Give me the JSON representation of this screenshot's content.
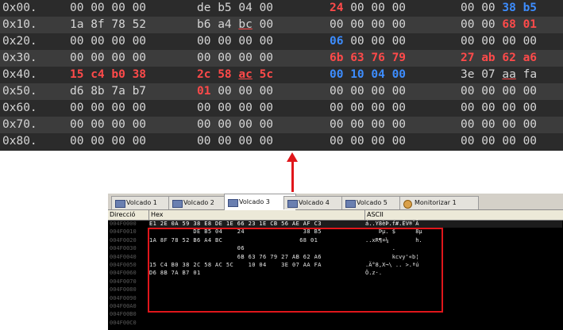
{
  "zoom": {
    "rows": [
      {
        "addr": "0x00.",
        "g1": [
          {
            "t": "00 00 00 00",
            "c": "def"
          }
        ],
        "g2": [
          {
            "t": "de b5 04 00",
            "c": "def"
          }
        ],
        "g3": [
          {
            "t": "24",
            "c": "red"
          },
          {
            "t": " 00 00 00",
            "c": "def"
          }
        ],
        "g4": [
          {
            "t": "00 00 ",
            "c": "def"
          },
          {
            "t": "38 b5",
            "c": "blue"
          }
        ]
      },
      {
        "addr": "0x10.",
        "g1": [
          {
            "t": "1a 8f 78 52",
            "c": "def"
          }
        ],
        "g2": [
          {
            "t": "b6 a4 ",
            "c": "def"
          },
          {
            "t": "bc",
            "c": "def",
            "u": true
          },
          {
            "t": " 00",
            "c": "def"
          }
        ],
        "g3": [
          {
            "t": "00 00 00 00",
            "c": "def"
          }
        ],
        "g4": [
          {
            "t": "00 00 ",
            "c": "def"
          },
          {
            "t": "68 01",
            "c": "red"
          }
        ]
      },
      {
        "addr": "0x20.",
        "g1": [
          {
            "t": "00 00 00 00",
            "c": "def"
          }
        ],
        "g2": [
          {
            "t": "00 00 00 00",
            "c": "def"
          }
        ],
        "g3": [
          {
            "t": "06",
            "c": "blue"
          },
          {
            "t": " 00 00 00",
            "c": "def"
          }
        ],
        "g4": [
          {
            "t": "00 00 00 00",
            "c": "def"
          }
        ]
      },
      {
        "addr": "0x30.",
        "g1": [
          {
            "t": "00 00 00 00",
            "c": "def"
          }
        ],
        "g2": [
          {
            "t": "00 00 00 00",
            "c": "def"
          }
        ],
        "g3": [
          {
            "t": "6b 63 76 79",
            "c": "red"
          }
        ],
        "g4": [
          {
            "t": "27 ab 62 a6",
            "c": "red"
          }
        ]
      },
      {
        "addr": "0x40.",
        "g1": [
          {
            "t": "15 c4 b0 38",
            "c": "red"
          }
        ],
        "g2": [
          {
            "t": "2c 58 ",
            "c": "red"
          },
          {
            "t": "ac",
            "c": "red",
            "u": true
          },
          {
            "t": " 5c",
            "c": "red"
          }
        ],
        "g3": [
          {
            "t": "00 10 04 00",
            "c": "blue"
          }
        ],
        "g4": [
          {
            "t": "3e 07 ",
            "c": "def"
          },
          {
            "t": "aa",
            "c": "def",
            "u": true
          },
          {
            "t": " fa",
            "c": "def"
          }
        ]
      },
      {
        "addr": "0x50.",
        "g1": [
          {
            "t": "d6 8b 7a b7",
            "c": "def"
          }
        ],
        "g2": [
          {
            "t": "01",
            "c": "red"
          },
          {
            "t": " 00 00 00",
            "c": "def"
          }
        ],
        "g3": [
          {
            "t": "00 00 00 00",
            "c": "def"
          }
        ],
        "g4": [
          {
            "t": "00 00 00 00",
            "c": "def"
          }
        ]
      },
      {
        "addr": "0x60.",
        "g1": [
          {
            "t": "00 00 00 00",
            "c": "def"
          }
        ],
        "g2": [
          {
            "t": "00 00 00 00",
            "c": "def"
          }
        ],
        "g3": [
          {
            "t": "00 00 00 00",
            "c": "def"
          }
        ],
        "g4": [
          {
            "t": "00 00 00 00",
            "c": "def"
          }
        ]
      },
      {
        "addr": "0x70.",
        "g1": [
          {
            "t": "00 00 00 00",
            "c": "def"
          }
        ],
        "g2": [
          {
            "t": "00 00 00 00",
            "c": "def"
          }
        ],
        "g3": [
          {
            "t": "00 00 00 00",
            "c": "def"
          }
        ],
        "g4": [
          {
            "t": "00 00 00 00",
            "c": "def"
          }
        ]
      },
      {
        "addr": "0x80.",
        "g1": [
          {
            "t": "00 00 00 00",
            "c": "def"
          }
        ],
        "g2": [
          {
            "t": "00 00 00 00",
            "c": "def"
          }
        ],
        "g3": [
          {
            "t": "00 00 00 00",
            "c": "def"
          }
        ],
        "g4": [
          {
            "t": "00 00 00 00",
            "c": "def"
          }
        ]
      }
    ]
  },
  "colors": {
    "red": "#ff4a4a",
    "blue": "#3d8dff",
    "accent_red": "#e0161b"
  },
  "tabs": [
    {
      "label": "Volcado 1",
      "icon": "dump-icon",
      "active": false
    },
    {
      "label": "Volcado 2",
      "icon": "dump-icon",
      "active": false
    },
    {
      "label": "Volcado 3",
      "icon": "dump-icon",
      "active": true
    },
    {
      "label": "Volcado 4",
      "icon": "dump-icon",
      "active": false
    },
    {
      "label": "Volcado 5",
      "icon": "dump-icon",
      "active": false
    },
    {
      "label": "Monitorizar 1",
      "icon": "gear-icon",
      "active": false
    }
  ],
  "headers": {
    "address": "Direcció",
    "hex": "Hex",
    "ascii": "ASCII"
  },
  "dump": {
    "rows": [
      {
        "addr": "004F0000",
        "hex": "E1 2E 0A 59 38 E8 DE 1E 66 23 1E CB 56 AE AF C3",
        "ascii": "á..Y8èÞ.f#.ËV®¯Ã"
      },
      {
        "addr": "004F0010",
        "hex": "            DE B5 04    24                38 B5",
        "ascii": "    Þµ. $      8µ"
      },
      {
        "addr": "004F0020",
        "hex": "1A 8F 78 52 B6 A4 BC                     68 01",
        "ascii": "..xR¶¤¼        h."
      },
      {
        "addr": "004F0030",
        "hex": "                        06",
        "ascii": "        ."
      },
      {
        "addr": "004F0040",
        "hex": "                        6B 63 76 79 27 AB 62 A6",
        "ascii": "        kcvy'«b¦"
      },
      {
        "addr": "004F0050",
        "hex": "15 C4 B0 38 2C 58 AC 5C    10 04    3E 07 AA FA",
        "ascii": ".Ä°8,X¬\\ .. >.ªú"
      },
      {
        "addr": "004F0060",
        "hex": "D6 8B 7A B7 01",
        "ascii": "Ö.z·."
      },
      {
        "addr": "004F0070",
        "hex": "",
        "ascii": ""
      },
      {
        "addr": "004F0080",
        "hex": "",
        "ascii": ""
      },
      {
        "addr": "004F0090",
        "hex": "",
        "ascii": ""
      },
      {
        "addr": "004F00A0",
        "hex": "",
        "ascii": ""
      },
      {
        "addr": "004F00B0",
        "hex": "",
        "ascii": ""
      },
      {
        "addr": "004F00C0",
        "hex": "",
        "ascii": ""
      }
    ]
  }
}
